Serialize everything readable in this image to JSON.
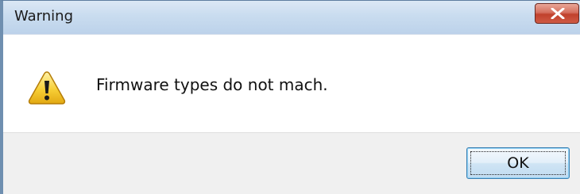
{
  "dialog": {
    "title": "Warning",
    "message": "Firmware types do not mach.",
    "ok_label": "OK",
    "close_icon": "close-icon",
    "warning_icon": "warning-icon"
  },
  "colors": {
    "titlebar": "#c9dcef",
    "close_button": "#c0412c",
    "footer": "#f0f0f0",
    "ok_border": "#3c7fb1"
  }
}
